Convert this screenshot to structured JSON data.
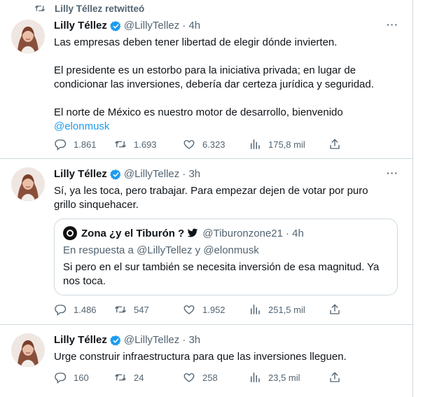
{
  "retweet_label": "Lilly Téllez retwitteó",
  "tweets": [
    {
      "name": "Lilly Téllez",
      "handle": "@LillyTellez",
      "time": "· 4h",
      "paragraphs": [
        "Las empresas deben tener libertad de elegir dónde invierten.",
        "El presidente es un estorbo para la iniciativa privada; en lugar de condicionar las inversiones, debería dar certeza jurídica y seguridad.",
        "El norte de México es nuestro motor de desarrollo, bienvenido"
      ],
      "mention": "@elonmusk",
      "stats": {
        "replies": "1.861",
        "retweets": "1.693",
        "likes": "6.323",
        "views": "175,8 mil"
      }
    },
    {
      "name": "Lilly Téllez",
      "handle": "@LillyTellez",
      "time": "· 3h",
      "text": "Sí, ya les toca, pero trabajar. Para empezar dejen de votar por puro grillo sinquehacer.",
      "quote": {
        "name": "Zona ¿y el Tiburón ?",
        "handle": "@Tiburonzone21",
        "time": "· 4h",
        "reply_to": "En respuesta a @LillyTellez y @elonmusk",
        "text": "Si pero en el sur también se necesita inversión de esa magnitud. Ya nos toca."
      },
      "stats": {
        "replies": "1.486",
        "retweets": "547",
        "likes": "1.952",
        "views": "251,5 mil"
      }
    },
    {
      "name": "Lilly Téllez",
      "handle": "@LillyTellez",
      "time": "· 3h",
      "text": "Urge construir infraestructura para que las inversiones lleguen.",
      "stats": {
        "replies": "160",
        "retweets": "24",
        "likes": "258",
        "views": "23,5 mil"
      }
    }
  ],
  "more_label": "···",
  "icons": [
    "retweet-icon",
    "verified-badge-icon",
    "reply-icon",
    "like-icon",
    "views-icon",
    "share-icon",
    "twitter-bird-icon"
  ],
  "colors": {
    "verified": "#1d9bf0",
    "link": "#1d9bf0",
    "secondary_text": "#536471",
    "divider": "#cfd9de"
  }
}
